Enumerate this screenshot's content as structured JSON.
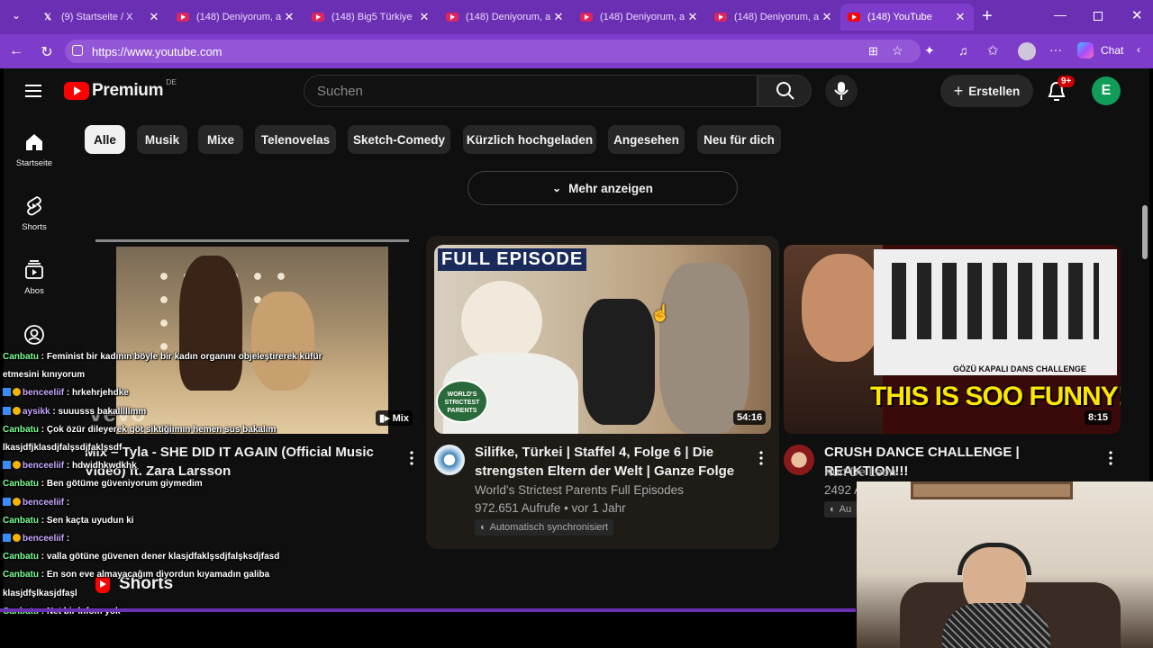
{
  "browser": {
    "tabs": [
      {
        "label": "(9) Startseite / X",
        "icon": "x-icon"
      },
      {
        "label": "(148) Deniyorum, a",
        "icon": "youtube-icon"
      },
      {
        "label": "(148) Big5 Türkiye",
        "icon": "youtube-icon"
      },
      {
        "label": "(148) Deniyorum, a",
        "icon": "youtube-icon"
      },
      {
        "label": "(148) Deniyorum, a",
        "icon": "youtube-icon"
      },
      {
        "label": "(148) Deniyorum, a",
        "icon": "youtube-icon"
      },
      {
        "label": "(148) YouTube",
        "icon": "youtube-icon",
        "active": true
      }
    ],
    "url": "https://www.youtube.com",
    "chat_label": "Chat"
  },
  "youtube": {
    "logo_text": "Premium",
    "region": "DE",
    "search_placeholder": "Suchen",
    "create_label": "Erstellen",
    "notification_count": "9+",
    "avatar_letter": "E",
    "sidebar": [
      {
        "label": "Startseite",
        "icon": "home-icon"
      },
      {
        "label": "Shorts",
        "icon": "shorts-icon"
      },
      {
        "label": "Abos",
        "icon": "subscriptions-icon"
      }
    ],
    "chips": [
      "Alle",
      "Musik",
      "Mixe",
      "Telenovelas",
      "Sketch-Comedy",
      "Kürzlich hochgeladen",
      "Angesehen",
      "Neu für dich"
    ],
    "more_label": "Mehr anzeigen",
    "videos": [
      {
        "title": "Mix – Tyla - SHE DID IT AGAIN (Official Music Video) ft. Zara Larsson",
        "badge": "Mix",
        "watermark": "vevo"
      },
      {
        "title": "Silifke, Türkei | Staffel 4, Folge 6 | Die strengsten Eltern der Welt | Ganze Folge",
        "channel": "World's Strictest Parents Full Episodes",
        "stats": "972.651 Aufrufe • vor 1 Jahr",
        "tag": "Automatisch synchronisiert",
        "duration": "54:16",
        "overlay": "FULL EPISODE",
        "sticker": "WORLD'S STRICTEST PARENTS"
      },
      {
        "title": "CRUSH DANCE CHALLENGE | REAKTION!!!",
        "channel": "Kurt De Leon",
        "stats": "2492 A",
        "tag": "Au",
        "duration": "8:15",
        "overlay": "THIS IS SOO FUNNY!!",
        "overlay_small": "GÖZÜ KAPALI DANS CHALLENGE"
      }
    ],
    "shorts_label": "Shorts"
  },
  "chat": [
    {
      "user": "Canbatu",
      "msg": "Feminist bir kadının böyle bir kadın organını objeleştirerek küfür"
    },
    {
      "user": "",
      "msg": "etmesini kınıyorum"
    },
    {
      "user": "benceeliif",
      "msg": "hrkehrjehdke",
      "style": "b"
    },
    {
      "user": "aysikk",
      "msg": "suuusss bakalllllmm",
      "style": "b"
    },
    {
      "user": "Canbatu",
      "msg": "Çok özür dileyerek göt siktiğiımın hemen sus bakalım"
    },
    {
      "user": "",
      "msg": "lkasjdfjklasdjfalşsdjfaklşsdf"
    },
    {
      "user": "benceeliif",
      "msg": "hdwidhkwdkhk",
      "style": "b"
    },
    {
      "user": "Canbatu",
      "msg": "Ben götüme güveniyorum giymedim"
    },
    {
      "user": "benceeliif",
      "msg": "",
      "style": "b"
    },
    {
      "user": "Canbatu",
      "msg": "Sen kaçta uyudun ki"
    },
    {
      "user": "benceeliif",
      "msg": "",
      "style": "b"
    },
    {
      "user": "Canbatu",
      "msg": "valla götüne güvenen dener klasjdfaklşsdjfalşksdjfasd"
    },
    {
      "user": "Canbatu",
      "msg": "En son eve almayacağım diyordun kıyamadın galiba"
    },
    {
      "user": "",
      "msg": "klasjdfşlkasjdfaşl"
    },
    {
      "user": "Canbatu",
      "msg": "Net bir lnfom yok"
    }
  ],
  "colors": {
    "brand": "#ff0000",
    "browser_tabbar": "#6b2fb3",
    "browser_addr": "#7e3ccb",
    "page_bg": "#0f0f0f",
    "chip_bg": "#272727"
  }
}
